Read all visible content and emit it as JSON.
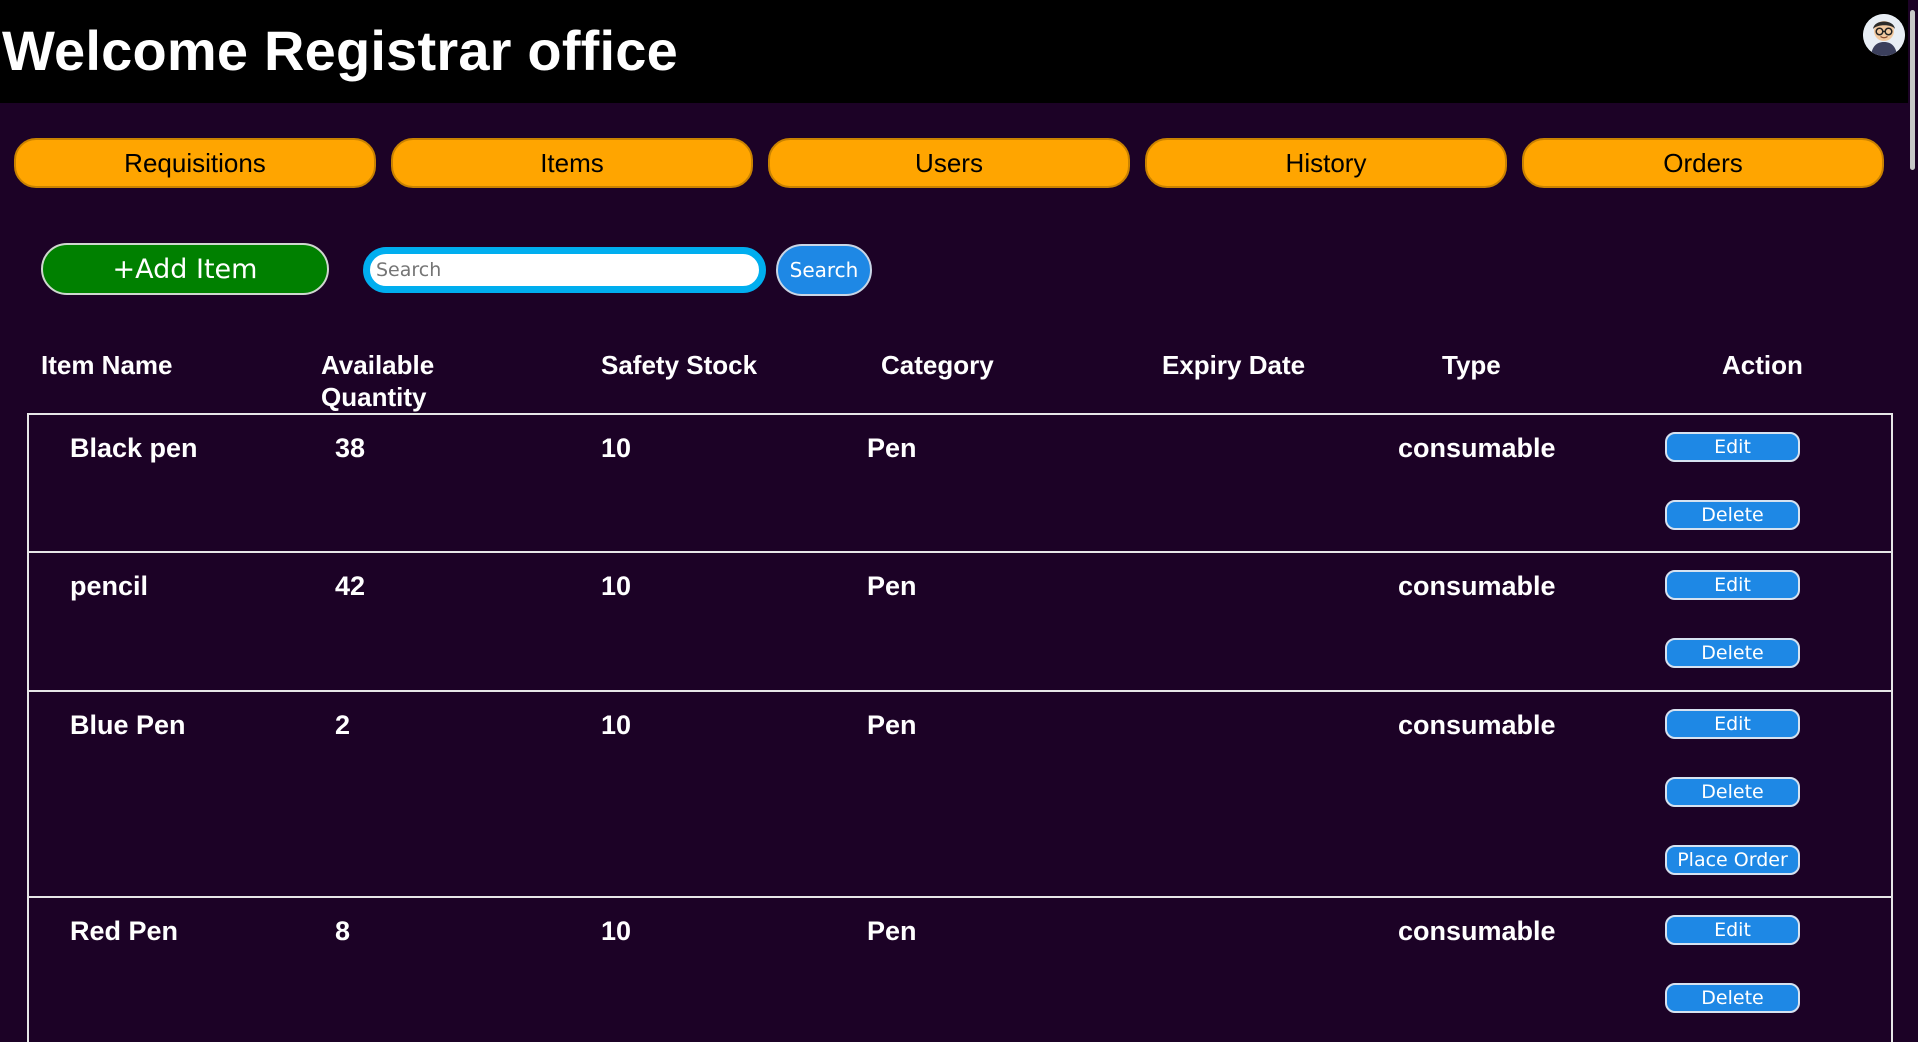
{
  "header": {
    "title": "Welcome Registrar office"
  },
  "nav": [
    "Requisitions",
    "Items",
    "Users",
    "History",
    "Orders"
  ],
  "toolbar": {
    "add_label": "+Add Item",
    "search_placeholder": "Search",
    "search_label": "Search"
  },
  "table": {
    "columns": [
      "Item Name",
      "Available Quantity",
      "Safety Stock",
      "Category",
      "Expiry Date",
      "Type",
      "Action"
    ],
    "rows": [
      {
        "name": "Black pen",
        "qty": "38",
        "safety": "10",
        "category": "Pen",
        "expiry": "",
        "type": "consumable",
        "actions": [
          "Edit",
          "Delete"
        ]
      },
      {
        "name": "pencil",
        "qty": "42",
        "safety": "10",
        "category": "Pen",
        "expiry": "",
        "type": "consumable",
        "actions": [
          "Edit",
          "Delete"
        ]
      },
      {
        "name": "Blue Pen",
        "qty": "2",
        "safety": "10",
        "category": "Pen",
        "expiry": "",
        "type": "consumable",
        "actions": [
          "Edit",
          "Delete",
          "Place Order"
        ]
      },
      {
        "name": "Red Pen",
        "qty": "8",
        "safety": "10",
        "category": "Pen",
        "expiry": "",
        "type": "consumable",
        "actions": [
          "Edit",
          "Delete"
        ]
      }
    ]
  },
  "colors": {
    "accent": "#ffa500",
    "button_blue": "#1e88e5",
    "add_green": "#008000",
    "background": "#1c0226"
  },
  "icons": {
    "avatar": "user-avatar-icon"
  }
}
